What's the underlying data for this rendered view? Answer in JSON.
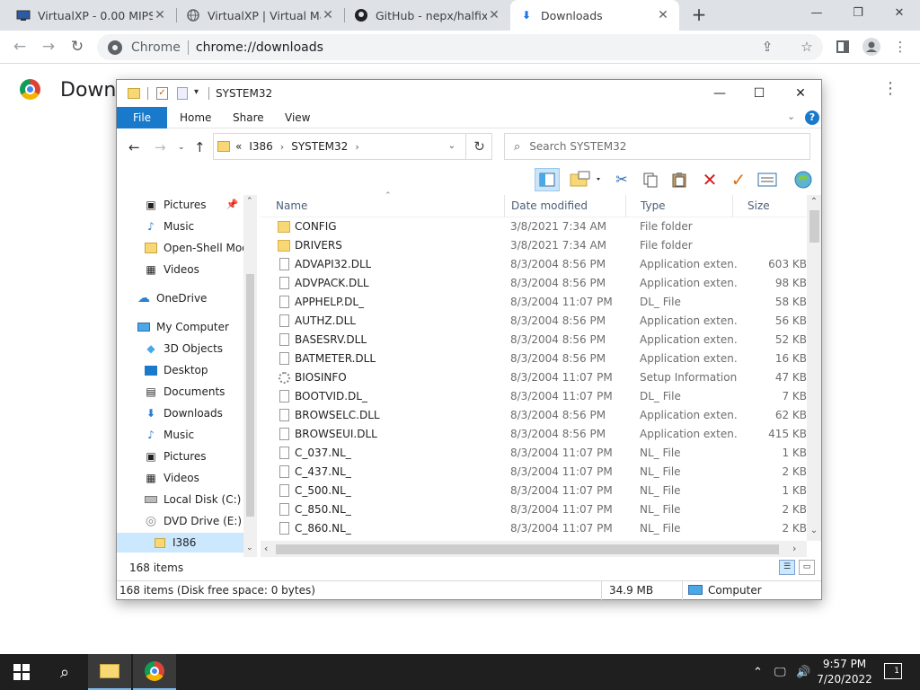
{
  "browser": {
    "tabs": [
      {
        "title": "VirtualXP - 0.00 MIPS",
        "icon": "monitor-icon"
      },
      {
        "title": "VirtualXP | Virtual Mac",
        "icon": "globe-icon"
      },
      {
        "title": "GitHub - nepx/halfix: x",
        "icon": "github-icon"
      },
      {
        "title": "Downloads",
        "icon": "download-icon"
      }
    ],
    "new_tab": "+",
    "omnibox_chip": "Chrome",
    "url": "chrome://downloads",
    "window_controls": {
      "minimize": "—",
      "restore": "❐",
      "close": "✕"
    }
  },
  "downloads_page": {
    "title_visible": "Downl",
    "menu_glyph": "⋮"
  },
  "explorer": {
    "title": "SYSTEM32",
    "ribbon_tabs": [
      "File",
      "Home",
      "Share",
      "View"
    ],
    "help": "?",
    "breadcrumb": [
      "«",
      "I386",
      "SYSTEM32"
    ],
    "search_placeholder": "Search SYSTEM32",
    "nav_items": [
      {
        "label": "Pictures",
        "icon": "pictures-icon",
        "pin": true
      },
      {
        "label": "Music",
        "icon": "music-icon"
      },
      {
        "label": "Open-Shell Mod",
        "icon": "folder-icon"
      },
      {
        "label": "Videos",
        "icon": "videos-icon"
      },
      {
        "label": "OneDrive",
        "icon": "onedrive-icon"
      },
      {
        "label": "My Computer",
        "icon": "computer-icon"
      },
      {
        "label": "3D Objects",
        "icon": "3d-objects-icon"
      },
      {
        "label": "Desktop",
        "icon": "desktop-icon"
      },
      {
        "label": "Documents",
        "icon": "documents-icon"
      },
      {
        "label": "Downloads",
        "icon": "downloads-icon"
      },
      {
        "label": "Music",
        "icon": "music-icon"
      },
      {
        "label": "Pictures",
        "icon": "pictures-icon"
      },
      {
        "label": "Videos",
        "icon": "videos-icon"
      },
      {
        "label": "Local Disk (C:)",
        "icon": "drive-icon"
      },
      {
        "label": "DVD Drive (E:) Vi",
        "icon": "dvd-icon"
      },
      {
        "label": "I386",
        "icon": "folder-icon",
        "selected": true
      }
    ],
    "columns": [
      "Name",
      "Date modified",
      "Type",
      "Size"
    ],
    "files": [
      {
        "name": "CONFIG",
        "date": "3/8/2021 7:34 AM",
        "type": "File folder",
        "size": "",
        "icon": "folder"
      },
      {
        "name": "DRIVERS",
        "date": "3/8/2021 7:34 AM",
        "type": "File folder",
        "size": "",
        "icon": "folder"
      },
      {
        "name": "ADVAPI32.DLL",
        "date": "8/3/2004 8:56 PM",
        "type": "Application exten...",
        "size": "603 KB",
        "icon": "file"
      },
      {
        "name": "ADVPACK.DLL",
        "date": "8/3/2004 8:56 PM",
        "type": "Application exten...",
        "size": "98 KB",
        "icon": "file"
      },
      {
        "name": "APPHELP.DL_",
        "date": "8/3/2004 11:07 PM",
        "type": "DL_ File",
        "size": "58 KB",
        "icon": "file"
      },
      {
        "name": "AUTHZ.DLL",
        "date": "8/3/2004 8:56 PM",
        "type": "Application exten...",
        "size": "56 KB",
        "icon": "file"
      },
      {
        "name": "BASESRV.DLL",
        "date": "8/3/2004 8:56 PM",
        "type": "Application exten...",
        "size": "52 KB",
        "icon": "file"
      },
      {
        "name": "BATMETER.DLL",
        "date": "8/3/2004 8:56 PM",
        "type": "Application exten...",
        "size": "16 KB",
        "icon": "file"
      },
      {
        "name": "BIOSINFO",
        "date": "8/3/2004 11:07 PM",
        "type": "Setup Information",
        "size": "47 KB",
        "icon": "gear"
      },
      {
        "name": "BOOTVID.DL_",
        "date": "8/3/2004 11:07 PM",
        "type": "DL_ File",
        "size": "7 KB",
        "icon": "file"
      },
      {
        "name": "BROWSELC.DLL",
        "date": "8/3/2004 8:56 PM",
        "type": "Application exten...",
        "size": "62 KB",
        "icon": "file"
      },
      {
        "name": "BROWSEUI.DLL",
        "date": "8/3/2004 8:56 PM",
        "type": "Application exten...",
        "size": "415 KB",
        "icon": "file"
      },
      {
        "name": "C_037.NL_",
        "date": "8/3/2004 11:07 PM",
        "type": "NL_ File",
        "size": "1 KB",
        "icon": "file"
      },
      {
        "name": "C_437.NL_",
        "date": "8/3/2004 11:07 PM",
        "type": "NL_ File",
        "size": "2 KB",
        "icon": "file"
      },
      {
        "name": "C_500.NL_",
        "date": "8/3/2004 11:07 PM",
        "type": "NL_ File",
        "size": "1 KB",
        "icon": "file"
      },
      {
        "name": "C_850.NL_",
        "date": "8/3/2004 11:07 PM",
        "type": "NL_ File",
        "size": "2 KB",
        "icon": "file"
      },
      {
        "name": "C_860.NL_",
        "date": "8/3/2004 11:07 PM",
        "type": "NL_ File",
        "size": "2 KB",
        "icon": "file"
      }
    ],
    "item_count": "168 items",
    "status": {
      "left": "168 items (Disk free space: 0 bytes)",
      "size": "34.9 MB",
      "location": "Computer"
    }
  },
  "taskbar": {
    "time": "9:57 PM",
    "date": "7/20/2022",
    "notifications": "1"
  }
}
